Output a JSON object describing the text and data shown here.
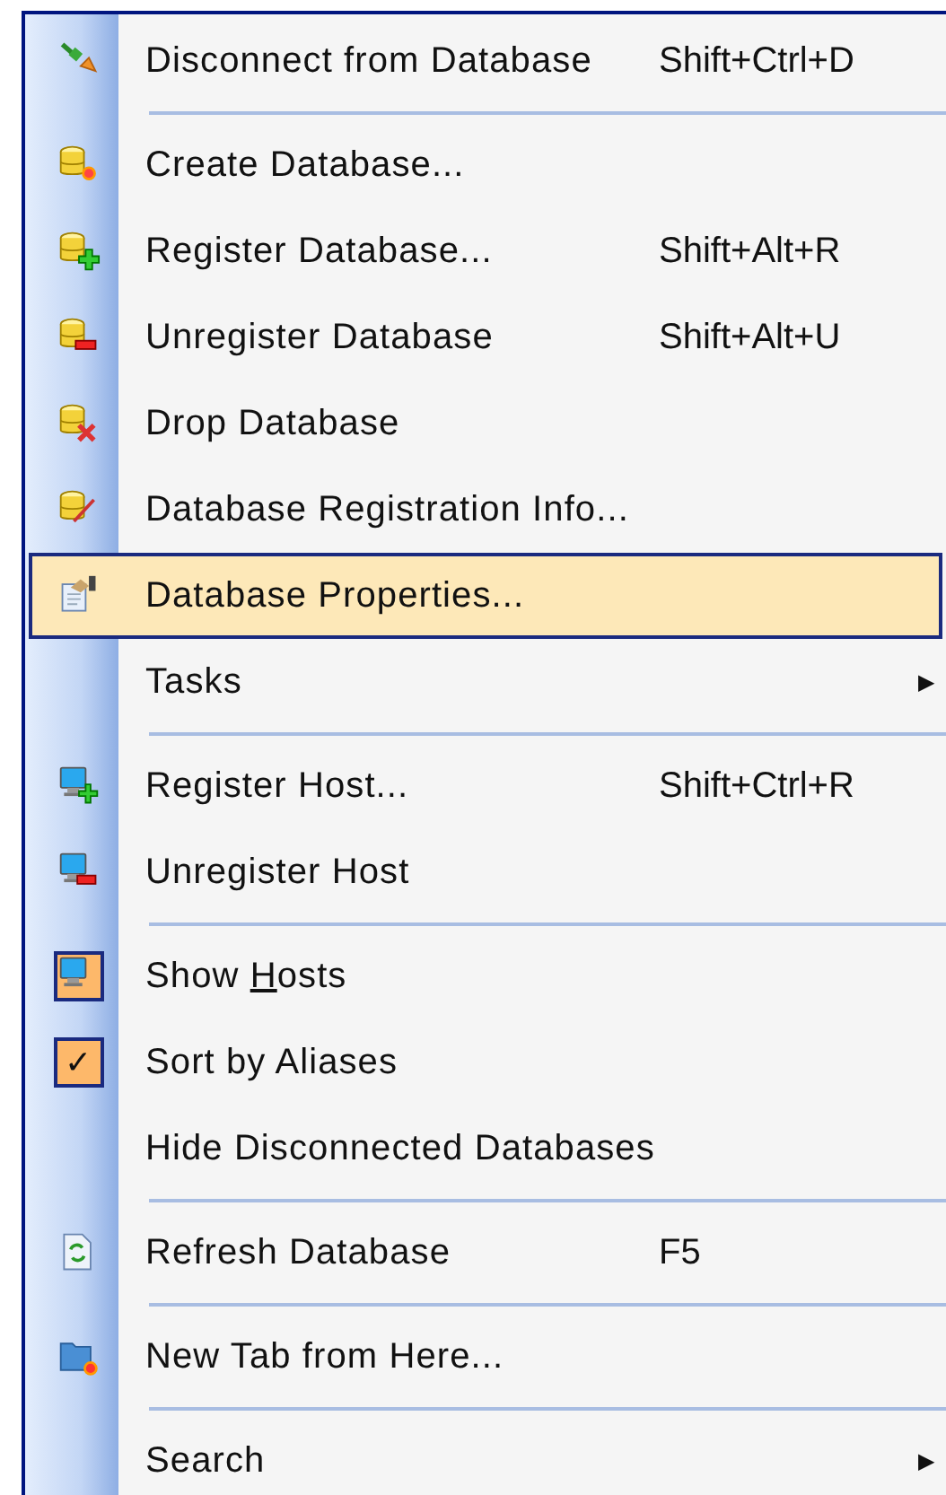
{
  "menu": {
    "items": [
      {
        "kind": "command",
        "label": "Disconnect from Database",
        "shortcut": "Shift+Ctrl+D",
        "selected": false,
        "checked": false
      },
      {
        "kind": "separator"
      },
      {
        "kind": "command",
        "label": "Create Database...",
        "selected": false,
        "checked": false
      },
      {
        "kind": "command",
        "label": "Register Database...",
        "shortcut": "Shift+Alt+R",
        "selected": false,
        "checked": false
      },
      {
        "kind": "command",
        "label": "Unregister Database",
        "shortcut": "Shift+Alt+U",
        "selected": false,
        "checked": false
      },
      {
        "kind": "command",
        "label": "Drop Database",
        "selected": false,
        "checked": false
      },
      {
        "kind": "command",
        "label": "Database Registration Info...",
        "selected": false,
        "checked": false
      },
      {
        "kind": "command",
        "label": "Database Properties...",
        "selected": true,
        "checked": false
      },
      {
        "kind": "submenu",
        "label": "Tasks",
        "arrow": "▶",
        "selected": false,
        "checked": false
      },
      {
        "kind": "separator"
      },
      {
        "kind": "command",
        "label": "Register Host...",
        "shortcut": "Shift+Ctrl+R",
        "selected": false,
        "checked": false
      },
      {
        "kind": "command",
        "label": "Unregister Host",
        "selected": false,
        "checked": false
      },
      {
        "kind": "separator"
      },
      {
        "kind": "command",
        "label_before": "Show ",
        "mnemonic": "H",
        "label_after": "osts",
        "selected": false,
        "checked": true
      },
      {
        "kind": "command",
        "label": "Sort by Aliases",
        "check": "✓",
        "selected": false,
        "checked": true
      },
      {
        "kind": "command",
        "label": "Hide Disconnected Databases",
        "selected": false,
        "checked": false
      },
      {
        "kind": "separator"
      },
      {
        "kind": "command",
        "label": "Refresh Database",
        "shortcut": "F5",
        "selected": false,
        "checked": false
      },
      {
        "kind": "separator"
      },
      {
        "kind": "command",
        "label": "New Tab from Here...",
        "selected": false,
        "checked": false
      },
      {
        "kind": "separator"
      },
      {
        "kind": "submenu",
        "label": "Search",
        "arrow": "▶",
        "selected": false,
        "checked": false
      }
    ]
  }
}
